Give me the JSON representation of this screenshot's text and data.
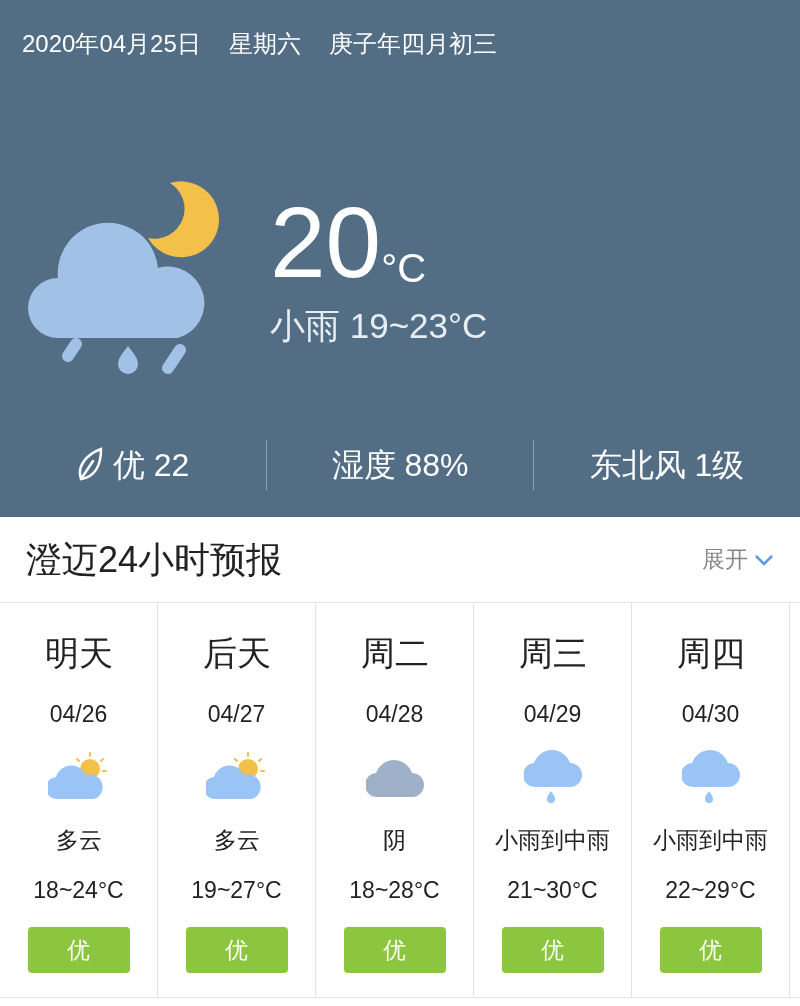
{
  "header": {
    "date": "2020年04月25日",
    "weekday": "星期六",
    "lunar": "庚子年四月初三"
  },
  "current": {
    "kind": "rain-night",
    "temperature": "20",
    "unit": "°C",
    "summary": "小雨 19~23°C"
  },
  "stats": [
    {
      "kind": "air",
      "text": "优 22"
    },
    {
      "kind": "plain",
      "text": "湿度 88%"
    },
    {
      "kind": "plain",
      "text": "东北风 1级"
    }
  ],
  "forecast": {
    "title": "澄迈24小时预报",
    "expand": "展开",
    "days": [
      {
        "day": "明天",
        "date": "04/26",
        "kind": "partly-cloudy",
        "condition": "多云",
        "temp": "18~24°C",
        "air": "优",
        "color": "#8cc63f"
      },
      {
        "day": "后天",
        "date": "04/27",
        "kind": "partly-cloudy",
        "condition": "多云",
        "temp": "19~27°C",
        "air": "优",
        "color": "#8cc63f"
      },
      {
        "day": "周二",
        "date": "04/28",
        "kind": "overcast",
        "condition": "阴",
        "temp": "18~28°C",
        "air": "优",
        "color": "#8cc63f"
      },
      {
        "day": "周三",
        "date": "04/29",
        "kind": "rain",
        "condition": "小雨到中雨",
        "temp": "21~30°C",
        "air": "优",
        "color": "#8cc63f"
      },
      {
        "day": "周四",
        "date": "04/30",
        "kind": "rain",
        "condition": "小雨到中雨",
        "temp": "22~29°C",
        "air": "优",
        "color": "#8cc63f"
      }
    ]
  }
}
